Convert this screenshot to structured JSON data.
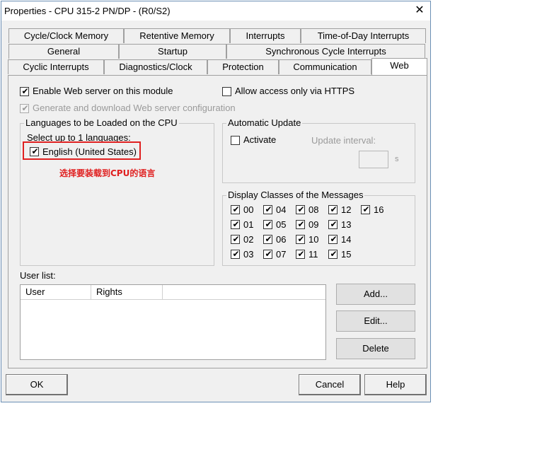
{
  "window": {
    "title": "Properties - CPU 315-2 PN/DP - (R0/S2)",
    "close_glyph": "✕"
  },
  "tabs": {
    "row1": [
      "Cycle/Clock Memory",
      "Retentive Memory",
      "Interrupts",
      "Time-of-Day Interrupts"
    ],
    "row2": [
      "General",
      "Startup",
      "Synchronous Cycle Interrupts"
    ],
    "row3": [
      "Cyclic Interrupts",
      "Diagnostics/Clock",
      "Protection",
      "Communication",
      "Web"
    ],
    "active": "Web"
  },
  "web": {
    "enable_server": {
      "label": "Enable Web server on this module",
      "checked": true
    },
    "https_only": {
      "label": "Allow access only via HTTPS",
      "checked": false
    },
    "generate_config": {
      "label": "Generate and download Web server configuration",
      "checked": true,
      "disabled": true
    },
    "languages": {
      "title": "Languages to be Loaded on the CPU",
      "hint": "Select up to 1 languages:",
      "items": [
        {
          "label": "English (United States)",
          "checked": true
        }
      ],
      "annotation": "选择要装载到CPU的语言"
    },
    "auto_update": {
      "title": "Automatic Update",
      "activate_label": "Activate",
      "activate_checked": false,
      "interval_label": "Update interval:",
      "interval_value": "",
      "unit": "s"
    },
    "message_classes": {
      "title": "Display Classes of the Messages",
      "columns": [
        [
          "00",
          "01",
          "02",
          "03"
        ],
        [
          "04",
          "05",
          "06",
          "07"
        ],
        [
          "08",
          "09",
          "10",
          "11"
        ],
        [
          "12",
          "13",
          "14",
          "15"
        ],
        [
          "16"
        ]
      ]
    },
    "user_list": {
      "label": "User list:",
      "columns": [
        "User",
        "Rights"
      ],
      "rows": []
    },
    "buttons": {
      "add": "Add...",
      "edit": "Edit...",
      "delete": "Delete"
    }
  },
  "footer": {
    "ok": "OK",
    "cancel": "Cancel",
    "help": "Help"
  },
  "colors": {
    "annotation_red": "#e02020",
    "dialog_bg": "#f0f0f0",
    "window_border": "#6b8fb5"
  },
  "icons": {
    "check": "✔"
  }
}
